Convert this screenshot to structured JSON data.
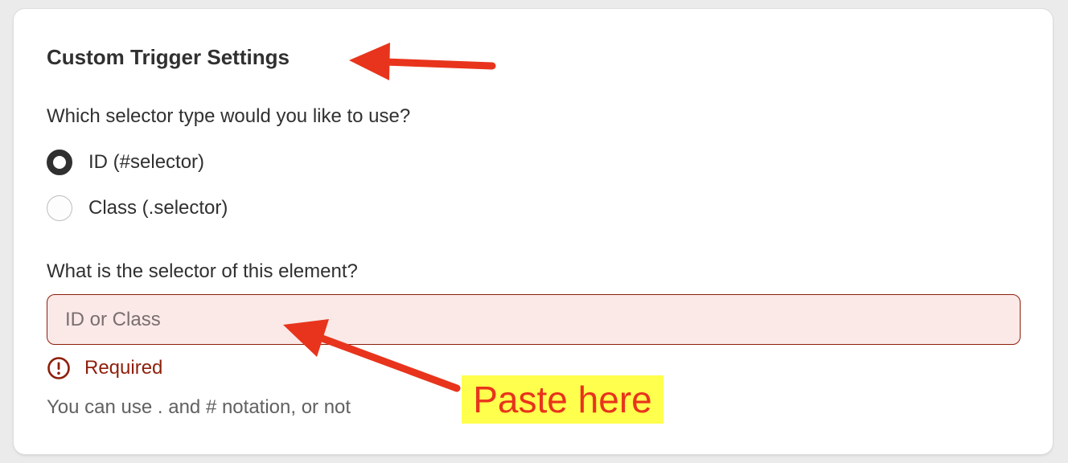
{
  "card": {
    "title": "Custom Trigger Settings"
  },
  "selector_type": {
    "question": "Which selector type would you like to use?",
    "options": [
      {
        "label": "ID (#selector)",
        "checked": true
      },
      {
        "label": "Class (.selector)",
        "checked": false
      }
    ]
  },
  "selector_field": {
    "label": "What is the selector of this element?",
    "value": "",
    "placeholder": "ID or Class",
    "error": "Required",
    "help_text": "You can use . and # notation, or not"
  },
  "annotations": {
    "callout_text": "Paste here",
    "arrow_color": "#e8341c",
    "highlight_color": "#ffff4d"
  },
  "colors": {
    "error": "#8e1f0b",
    "field_error_background": "#fae9e7",
    "text": "#303030"
  },
  "icons": {
    "error": "alert-circle-icon"
  }
}
